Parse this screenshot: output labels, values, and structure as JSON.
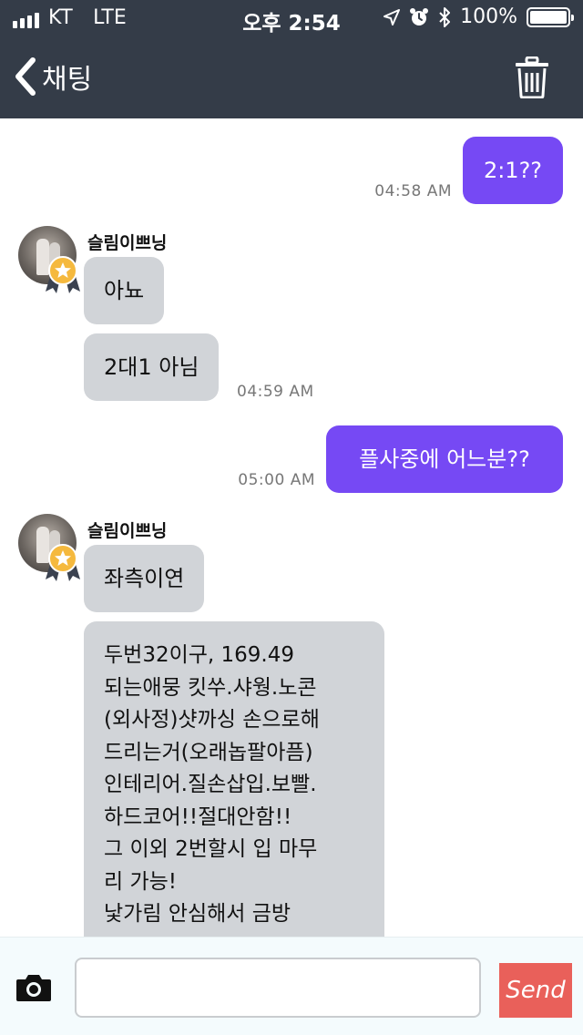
{
  "status_bar": {
    "carrier": "KT",
    "network": "LTE",
    "time": "오후 2:54",
    "battery_percent": "100%",
    "battery_level": 1.0
  },
  "nav": {
    "back_label": "채팅",
    "back_icon": "chevron-left-icon",
    "trash_icon": "trash-icon"
  },
  "messages": [
    {
      "direction": "out",
      "text": "2:1??",
      "time": "04:58 AM"
    },
    {
      "direction": "in",
      "sender": "슬림이쁘닝",
      "bubbles": [
        "아뇨",
        "2대1 아님"
      ],
      "time": "04:59 AM"
    },
    {
      "direction": "out",
      "text": "플사중에 어느분??",
      "time": "05:00 AM"
    },
    {
      "direction": "in",
      "sender": "슬림이쁘닝",
      "bubbles": [
        "좌측이연",
        "두번32이구, 169.49\n되는애뭉 킷쑤.샤웡.노콘\n(외사정)샷까싱 손으로해\n드리는거(오래놉팔아픔)\n인테리어.질손삽입.보빨.\n하드코어!!절대안함!!\n그 이외 2번할시 입 마무\n리 가능!\n낯가림 안심해서 금방"
      ]
    }
  ],
  "composer": {
    "placeholder": "",
    "value": "",
    "send_label": "Send",
    "camera_icon": "camera-icon"
  },
  "colors": {
    "header_bg": "#343c48",
    "outgoing_bubble": "#7649f4",
    "incoming_bubble": "#d1d4d8",
    "send_button": "#e9605a",
    "badge": "#f5b93e"
  }
}
